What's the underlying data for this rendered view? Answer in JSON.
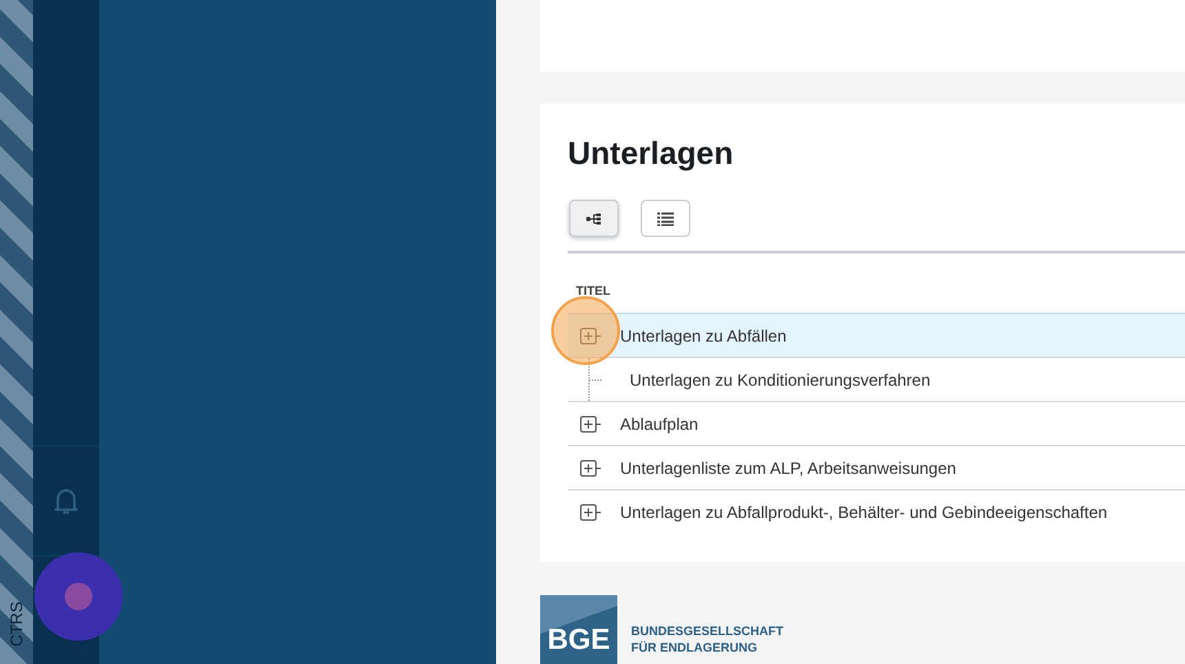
{
  "sidebar": {
    "label": "CTRS"
  },
  "panel": {
    "title": "Unterlagen",
    "view_buttons": [
      {
        "kind": "tree",
        "selected": true
      },
      {
        "kind": "list",
        "selected": false
      }
    ],
    "column": "TITEL",
    "rows": [
      {
        "kind": "expandable",
        "title": "Unterlagen zu Abfällen",
        "selected": true
      },
      {
        "kind": "leaf",
        "title": "Unterlagen zu Konditionierungsverfahren",
        "selected": false
      },
      {
        "kind": "expandable",
        "title": "Ablaufplan",
        "selected": false
      },
      {
        "kind": "expandable",
        "title": "Unterlagenliste zum ALP, Arbeitsanweisungen",
        "selected": false
      },
      {
        "kind": "expandable",
        "title": "Unterlagen zu Abfallprodukt-, Behälter- und Gebindeeigenschaften",
        "selected": false
      }
    ]
  },
  "footer": {
    "logo_mark": "BGE",
    "logo_lines": [
      "BUNDESGESELLSCHAFT",
      "FÜR ENDLAGERUNG"
    ]
  }
}
